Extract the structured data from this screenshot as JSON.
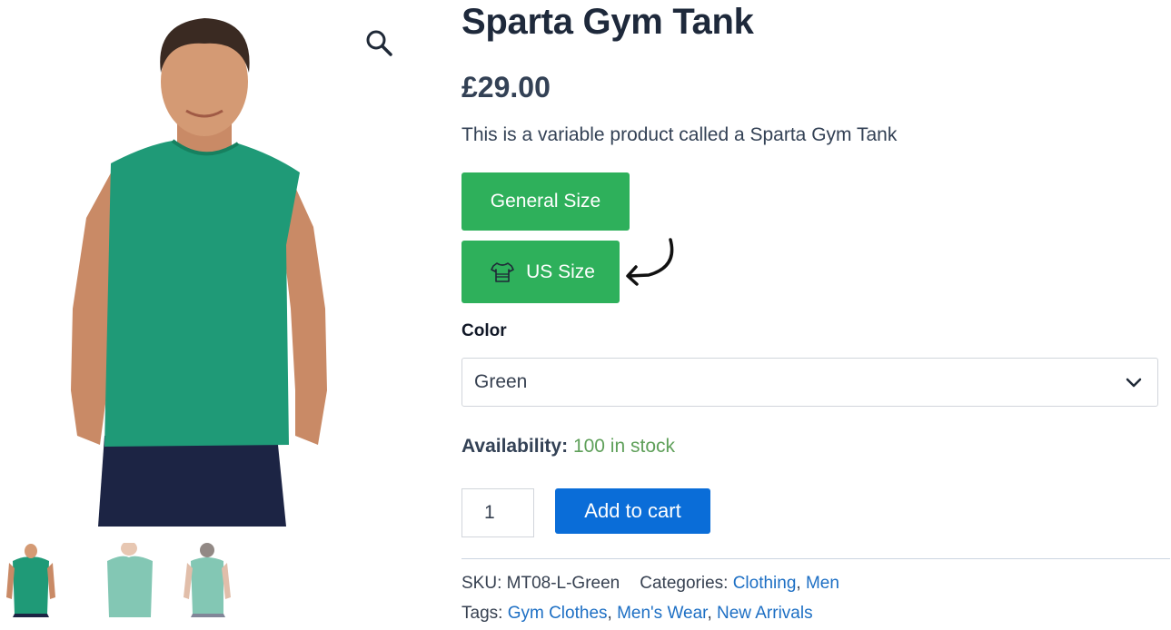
{
  "product": {
    "title": "Sparta Gym Tank",
    "price": "£29.00",
    "description": "This is a variable product called a Sparta Gym Tank"
  },
  "size_buttons": {
    "general": "General Size",
    "us": "US Size",
    "us_icon": "tshirt-icon"
  },
  "color": {
    "label": "Color",
    "selected": "Green"
  },
  "availability": {
    "label": "Availability:",
    "value": "100 in stock"
  },
  "cart": {
    "quantity": "1",
    "button": "Add to cart"
  },
  "meta": {
    "sku_label": "SKU:",
    "sku": "MT08-L-Green",
    "categories_label": "Categories:",
    "categories": [
      "Clothing",
      "Men"
    ],
    "tags_label": "Tags:",
    "tags": [
      "Gym Clothes",
      "Men's Wear",
      "New Arrivals"
    ],
    "separator": ","
  },
  "icons": {
    "zoom": "search-icon",
    "arrow": "curved-arrow-icon",
    "chevron": "chevron-down-icon"
  },
  "colors": {
    "size_button": "#2eb05b",
    "cart_button": "#0a6dd8",
    "in_stock": "#5fa05a",
    "link": "#1d6fc4",
    "tank": "#1f9a77"
  }
}
